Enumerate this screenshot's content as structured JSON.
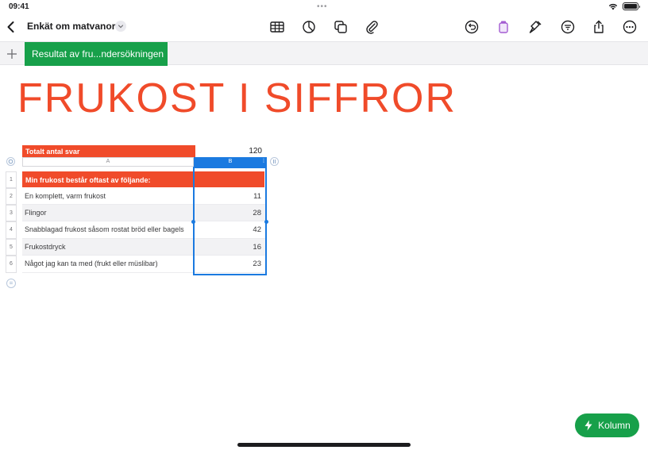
{
  "status_bar": {
    "time": "09:41",
    "center_dots": "•••"
  },
  "toolbar": {
    "document_title": "Enkät om matvanor",
    "icons": [
      "back-chevron-icon",
      "table-icon",
      "chart-icon",
      "shapes-icon",
      "paperclip-icon",
      "undo-icon",
      "format-paintbrush-icon",
      "format-icon",
      "filter-icon",
      "share-icon",
      "more-icon"
    ]
  },
  "sheets": {
    "add_label": "+",
    "active_tab": "Resultat av fru...ndersökningen",
    "active_color": "#17a04a"
  },
  "page_title": "FRUKOST I SIFFROR",
  "accent_color": "#f04b2a",
  "selection_color": "#1b7ae0",
  "table": {
    "summary_label": "Totalt antal svar",
    "summary_value": "120",
    "column_headers": [
      "A",
      "B"
    ],
    "row_numbers": [
      "1",
      "2",
      "3",
      "4",
      "5",
      "6"
    ],
    "header_row": "Min frukost består oftast av följande:",
    "rows": [
      {
        "label": "En komplett, varm frukost",
        "value": "11"
      },
      {
        "label": "Flingor",
        "value": "28"
      },
      {
        "label": "Snabblagad frukost såsom rostat bröd eller bagels",
        "value": "42"
      },
      {
        "label": "Frukostdryck",
        "value": "16"
      },
      {
        "label": "Något jag kan ta med (frukt eller müslibar)",
        "value": "23"
      }
    ]
  },
  "action_button": {
    "label": "Kolumn",
    "icon": "lightning-icon"
  }
}
